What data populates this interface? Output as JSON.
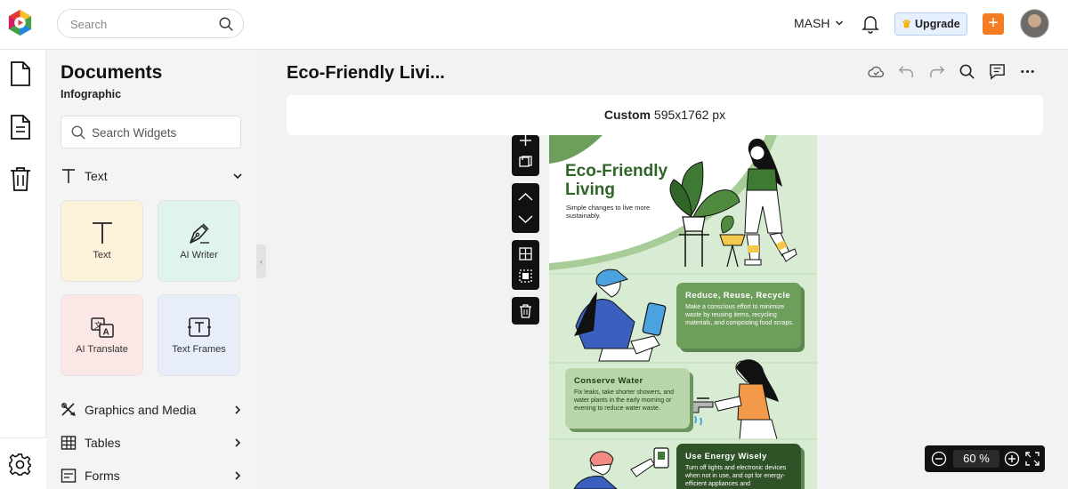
{
  "topbar": {
    "search_placeholder": "Search",
    "team_name": "MASH",
    "upgrade_label": "Upgrade",
    "brand_colors": [
      "#e53935",
      "#fbc02d",
      "#43a047",
      "#1e88e5"
    ],
    "accent": "#f57c22"
  },
  "panel": {
    "title": "Documents",
    "subtitle": "Infographic",
    "widget_search_placeholder": "Search Widgets",
    "text_section": "Text",
    "cards": [
      {
        "label": "Text",
        "icon": "text-icon",
        "bg": "#fdf3da"
      },
      {
        "label": "AI Writer",
        "icon": "pen-nib-icon",
        "bg": "#dff3ef"
      },
      {
        "label": "AI Translate",
        "icon": "translate-icon",
        "bg": "#fbe8e6"
      },
      {
        "label": "Text Frames",
        "icon": "text-frame-icon",
        "bg": "#e7eef9"
      }
    ],
    "sections": [
      {
        "label": "Graphics and Media",
        "icon": "graphics-icon"
      },
      {
        "label": "Tables",
        "icon": "table-icon"
      },
      {
        "label": "Forms",
        "icon": "form-icon"
      }
    ]
  },
  "workspace": {
    "doc_title": "Eco-Friendly Livi...",
    "size_label": "Custom",
    "size_value": "595x1762 px"
  },
  "infographic": {
    "title": "Eco-Friendly Living",
    "subtitle": "Simple changes to live more sustainably.",
    "blocks": [
      {
        "title": "Reduce, Reuse, Recycle",
        "body": "Make a conscious effort to minimize waste by reusing items, recycling materials, and composting food scraps."
      },
      {
        "title": "Conserve Water",
        "body": "Fix leaks, take shorter showers, and water plants in the early morning or evening to reduce water waste."
      },
      {
        "title": "Use Energy Wisely",
        "body": "Turn off lights and electronic devices when not in use, and opt for energy-efficient appliances and"
      }
    ],
    "colors": {
      "dark_green": "#2f6627",
      "mid_green": "#5c8751",
      "light_green": "#d7ecd2",
      "block_light": "#b8d6a9"
    }
  },
  "zoom": {
    "value": "60",
    "unit": "%"
  }
}
